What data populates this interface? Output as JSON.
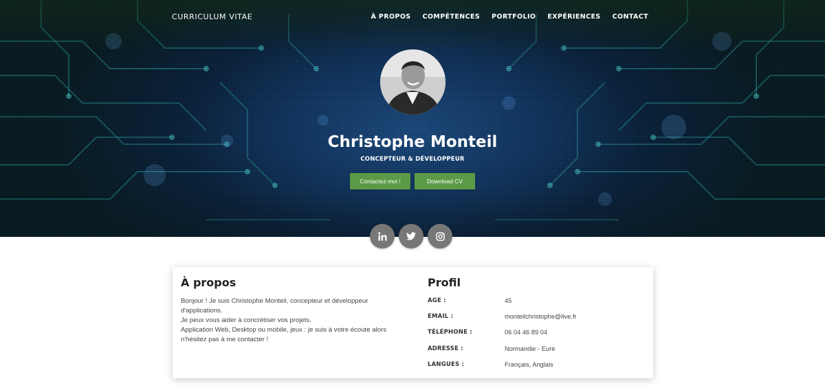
{
  "nav": {
    "brand": "CURRICULUM VITAE",
    "items": [
      "À PROPOS",
      "COMPÉTENCES",
      "PORTFOLIO",
      "EXPÉRIENCES",
      "CONTACT"
    ]
  },
  "hero": {
    "name": "Christophe Monteil",
    "subtitle": "CONCEPTEUR & DÉVELOPPEUR",
    "contact_button": "Contactez-moi !",
    "download_button": "Download CV"
  },
  "socials": [
    {
      "icon": "linkedin-icon"
    },
    {
      "icon": "twitter-icon"
    },
    {
      "icon": "instagram-icon"
    }
  ],
  "about": {
    "title": "À propos",
    "lines": [
      "Bonjour ! Je suis Christophe Monteil, concepteur et développeur d'applications.",
      "Je peux vous aider à concrétiser vos projets.",
      "Application Web, Desktop ou mobile, jeux : je suis à votre écoute alors n'hésitez pas à me contacter !"
    ]
  },
  "profile": {
    "title": "Profil",
    "rows": [
      {
        "label": "AGE :",
        "value": "45"
      },
      {
        "label": "EMAIL :",
        "value": "monteilchristophe@live.fr"
      },
      {
        "label": "TÉLÉPHONE :",
        "value": "06 04 46 89 04"
      },
      {
        "label": "ADRESSE :",
        "value": "Normandie - Eure"
      },
      {
        "label": "LANGUES :",
        "value": "Français, Anglais"
      }
    ]
  },
  "colors": {
    "accent_green": "#5b9a46",
    "hero_blue": "#1f4f86",
    "social_grey": "#777777"
  }
}
